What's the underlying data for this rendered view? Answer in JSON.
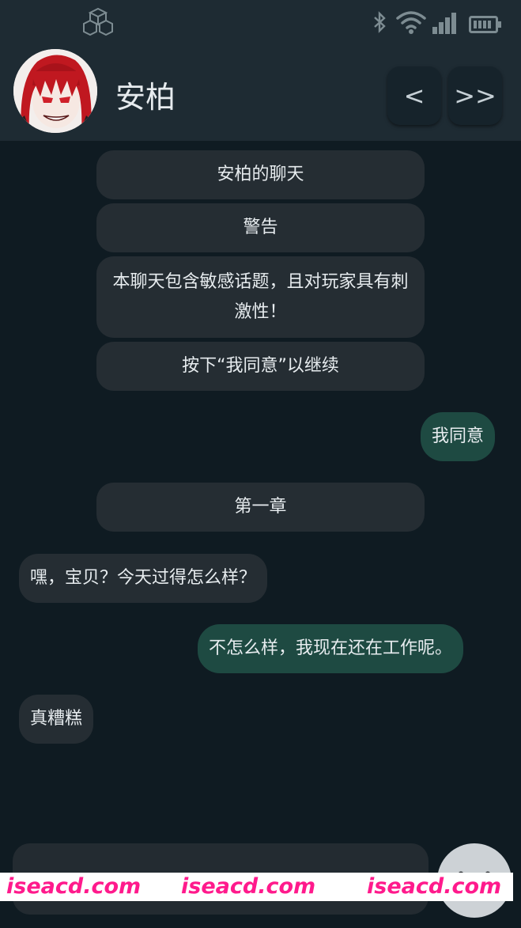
{
  "header": {
    "contact_name": "安柏",
    "prev_label": "<",
    "next_label": ">>"
  },
  "icons": {
    "status_logo": "cube-logo-icon",
    "bluetooth": "bluetooth-icon",
    "wifi": "wifi-icon",
    "signal": "cell-signal-icon",
    "battery": "battery-icon",
    "fab": "chevron-down-icon"
  },
  "messages": [
    {
      "role": "system",
      "text": "安柏的聊天"
    },
    {
      "role": "system",
      "text": "警告"
    },
    {
      "role": "system",
      "text": "本聊天包含敏感话题，且对玩家具有刺激性！"
    },
    {
      "role": "system",
      "text": "按下“我同意”以继续"
    },
    {
      "role": "user",
      "text": "我同意"
    },
    {
      "role": "system",
      "text": "第一章"
    },
    {
      "role": "bot",
      "text": "嘿，宝贝？今天过得怎么样？"
    },
    {
      "role": "user",
      "text": "不怎么样，我现在还在工作呢。"
    },
    {
      "role": "bot",
      "text": "真糟糕"
    }
  ],
  "composer": {
    "value": "",
    "placeholder": ""
  },
  "watermark": [
    "iseacd.com",
    "iseacd.com",
    "iseacd.com"
  ],
  "colors": {
    "background": "#0f1b22",
    "header": "#1e2b33",
    "system_bubble": "#252d33",
    "user_bubble": "#1e4a42",
    "watermark_text": "#ff1a8c"
  }
}
